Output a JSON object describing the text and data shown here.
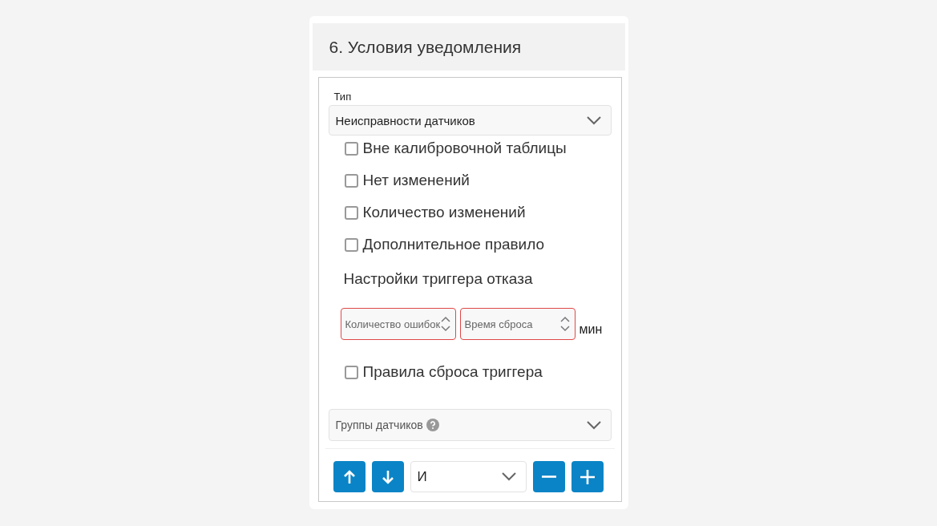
{
  "section": {
    "title": "6. Условия уведомления"
  },
  "type_field": {
    "label": "Тип",
    "value": "Неисправности датчиков"
  },
  "checkboxes_top": [
    {
      "label": "Вне калибровочной таблицы",
      "checked": false
    },
    {
      "label": "Нет изменений",
      "checked": false
    },
    {
      "label": "Количество изменений",
      "checked": false
    },
    {
      "label": "Дополнительное правило",
      "checked": false
    }
  ],
  "trigger": {
    "heading": "Настройки триггера отказа",
    "fields": [
      {
        "placeholder": "Количество ошибок",
        "invalid": true
      },
      {
        "placeholder": "Время сброса",
        "invalid": true
      }
    ],
    "unit": "мин"
  },
  "checkboxes_bottom": [
    {
      "label": "Правила сброса триггера",
      "checked": false
    }
  ],
  "groups_field": {
    "placeholder": "Группы датчиков"
  },
  "toolbar": {
    "operator": "И"
  }
}
